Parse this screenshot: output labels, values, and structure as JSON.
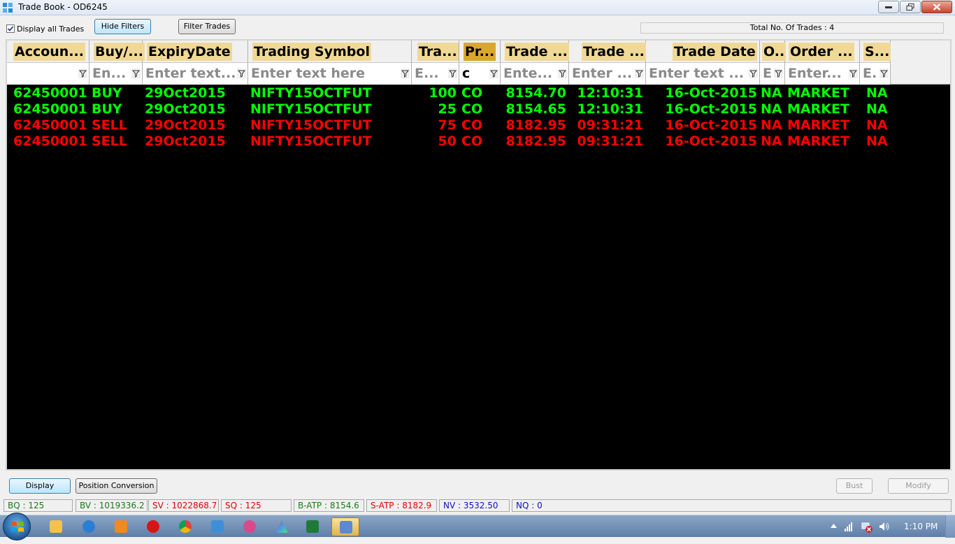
{
  "window": {
    "title": "Trade Book - OD6245"
  },
  "toolbar": {
    "display_all_label": "Display all Trades",
    "display_all_checked": true,
    "hide_filters_label": "Hide Filters",
    "filter_trades_label": "Filter Trades",
    "total_trades_text": "Total No. Of Trades : 4"
  },
  "columns": [
    {
      "header": "Accoun...",
      "filter": ""
    },
    {
      "header": "Buy/...",
      "filter": "En..."
    },
    {
      "header": "ExpiryDate",
      "filter": "Enter text..."
    },
    {
      "header": "Trading Symbol",
      "filter": "Enter text here"
    },
    {
      "header": "Tra...",
      "filter": "E..."
    },
    {
      "header": "Pr...",
      "filter": "c"
    },
    {
      "header": "Trade ...",
      "filter": "Ente..."
    },
    {
      "header": "Trade ...",
      "filter": "Enter ..."
    },
    {
      "header": "Trade Date",
      "filter": "Enter text ..."
    },
    {
      "header": "O..",
      "filter": "E"
    },
    {
      "header": "Order ...",
      "filter": "Enter..."
    },
    {
      "header": "S...",
      "filter": "E."
    }
  ],
  "trades": [
    {
      "account": "62450001",
      "side": "BUY",
      "expiry": "29Oct2015",
      "symbol": "NIFTY15OCTFUT",
      "qty": "100",
      "product": "CO",
      "price": "8154.70",
      "time": "12:10:31",
      "date": "16-Oct-2015",
      "o": "NA",
      "order_type": "MARKET",
      "s": "NA",
      "color": "#00ff00"
    },
    {
      "account": "62450001",
      "side": "BUY",
      "expiry": "29Oct2015",
      "symbol": "NIFTY15OCTFUT",
      "qty": "25",
      "product": "CO",
      "price": "8154.65",
      "time": "12:10:31",
      "date": "16-Oct-2015",
      "o": "NA",
      "order_type": "MARKET",
      "s": "NA",
      "color": "#00ff00"
    },
    {
      "account": "62450001",
      "side": "SELL",
      "expiry": "29Oct2015",
      "symbol": "NIFTY15OCTFUT",
      "qty": "75",
      "product": "CO",
      "price": "8182.95",
      "time": "09:31:21",
      "date": "16-Oct-2015",
      "o": "NA",
      "order_type": "MARKET",
      "s": "NA",
      "color": "#ff0000"
    },
    {
      "account": "62450001",
      "side": "SELL",
      "expiry": "29Oct2015",
      "symbol": "NIFTY15OCTFUT",
      "qty": "50",
      "product": "CO",
      "price": "8182.95",
      "time": "09:31:21",
      "date": "16-Oct-2015",
      "o": "NA",
      "order_type": "MARKET",
      "s": "NA",
      "color": "#ff0000"
    }
  ],
  "actions": {
    "display_label": "Display",
    "position_conversion_label": "Position Conversion",
    "bust_label": "Bust",
    "modify_label": "Modify"
  },
  "status": [
    {
      "text": "BQ : 125",
      "color": "#1a7a1a"
    },
    {
      "text": "BV : 1019336.2",
      "color": "#1a7a1a"
    },
    {
      "text": "SV : 1022868.7",
      "color": "#e00000"
    },
    {
      "text": "SQ : 125",
      "color": "#e00000"
    },
    {
      "text": "B-ATP : 8154.6",
      "color": "#1a7a1a"
    },
    {
      "text": "S-ATP : 8182.9",
      "color": "#e00000"
    },
    {
      "text": "NV : 3532.50",
      "color": "#1010c0"
    },
    {
      "text": "NQ : 0",
      "color": "#1010c0"
    }
  ],
  "taskbar": {
    "clock": "1:10 PM",
    "apps": [
      "explorer-icon",
      "ie-icon",
      "media-player-icon",
      "opera-icon",
      "chrome-icon",
      "puzzle-app-icon",
      "app-icon",
      "triangle-app-icon",
      "excel-icon",
      "trading-app-icon"
    ]
  }
}
